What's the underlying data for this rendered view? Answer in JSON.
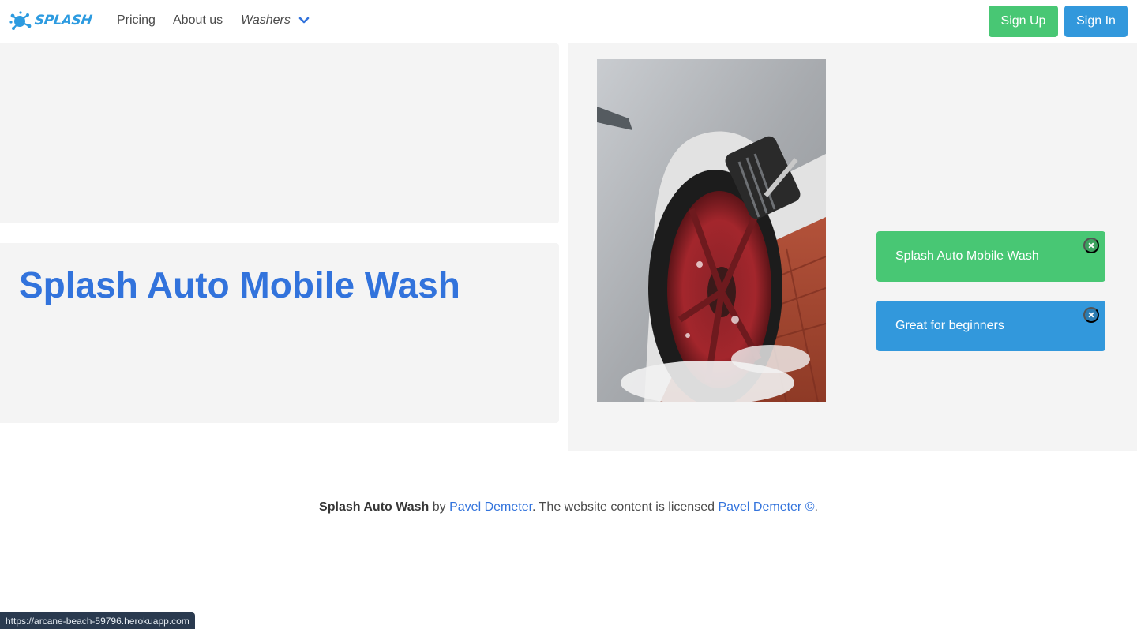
{
  "navbar": {
    "logo_text": "SPLASH",
    "links": [
      {
        "label": "Pricing"
      },
      {
        "label": "About us"
      },
      {
        "label": "Washers"
      }
    ],
    "sign_up_label": "Sign Up",
    "sign_in_label": "Sign In"
  },
  "hero": {
    "title": "Splash Auto Mobile Wash",
    "notifications": [
      {
        "text": "Splash Auto Mobile Wash",
        "color": "#48c774"
      },
      {
        "text": "Great for beginners",
        "color": "#3298dc"
      }
    ]
  },
  "footer": {
    "brand": "Splash Auto Wash",
    "by": " by ",
    "author_link": "Pavel Demeter",
    "license_text": ". The website content is licensed ",
    "license_link": "Pavel Demeter ©",
    "end": "."
  },
  "status_bar": {
    "url": "https://arcane-beach-59796.herokuapp.com"
  },
  "colors": {
    "accent_blue": "#3273dc",
    "green": "#48c774",
    "info_blue": "#3298dc"
  }
}
